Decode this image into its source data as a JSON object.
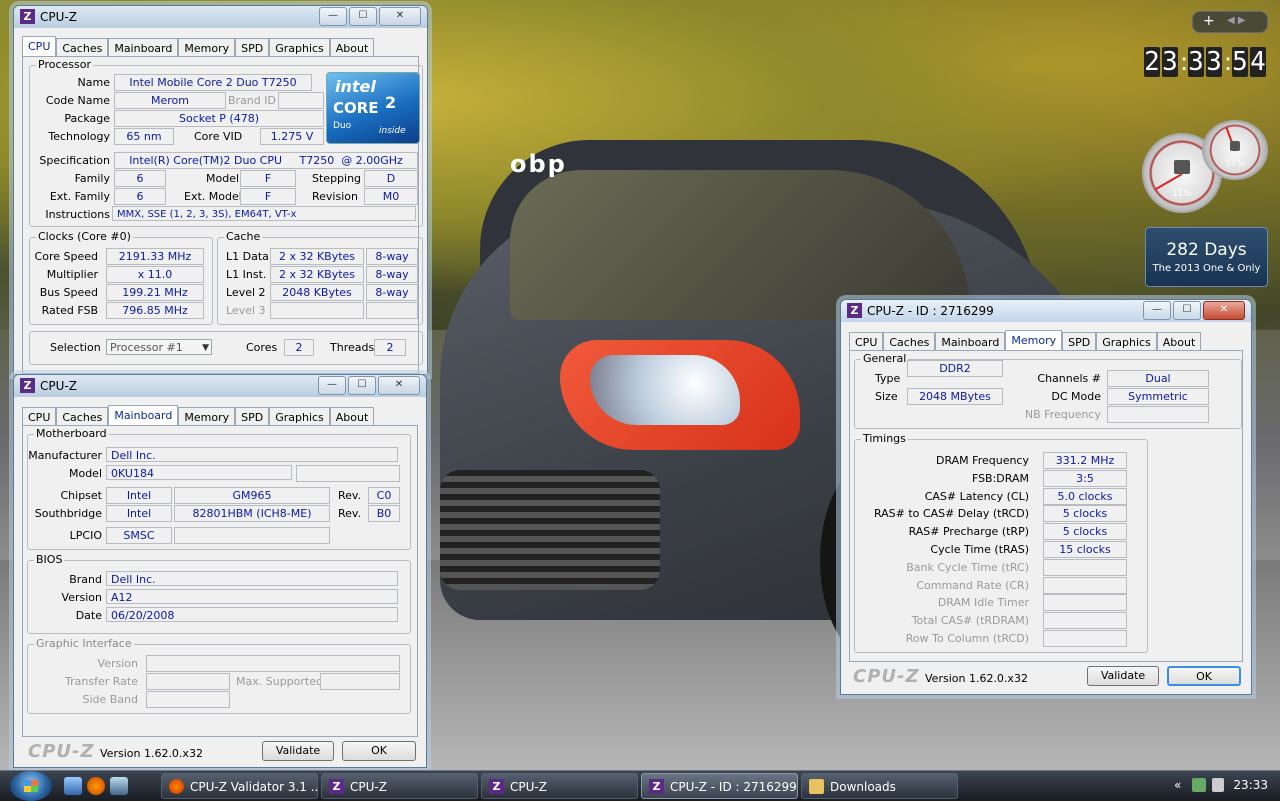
{
  "desktop": {
    "clock_digits": [
      "2",
      "3",
      "3",
      "3",
      "5",
      "4"
    ],
    "countdown": {
      "value": "282 Days",
      "caption": "The 2013 One & Only"
    },
    "meters": [
      {
        "label": "11%"
      },
      {
        "label": "57%"
      }
    ],
    "car_sticker": "obp"
  },
  "win_cpu": {
    "title": "CPU-Z",
    "tabs": [
      "CPU",
      "Caches",
      "Mainboard",
      "Memory",
      "SPD",
      "Graphics",
      "About"
    ],
    "processor": {
      "group": "Processor",
      "name_label": "Name",
      "name": "Intel Mobile Core 2 Duo T7250",
      "codename_label": "Code Name",
      "codename": "Merom",
      "brandid_label": "Brand ID",
      "package_label": "Package",
      "package": "Socket P (478)",
      "tech_label": "Technology",
      "tech": "65 nm",
      "corevid_label": "Core VID",
      "corevid": "1.275 V",
      "spec_label": "Specification",
      "spec": "Intel(R) Core(TM)2 Duo CPU     T7250  @ 2.00GHz",
      "family_label": "Family",
      "family": "6",
      "model_label": "Model",
      "model": "F",
      "stepping_label": "Stepping",
      "stepping": "D",
      "extfamily_label": "Ext. Family",
      "extfamily": "6",
      "extmodel_label": "Ext. Model",
      "extmodel": "F",
      "revision_label": "Revision",
      "revision": "M0",
      "instr_label": "Instructions",
      "instr": "MMX, SSE (1, 2, 3, 3S), EM64T, VT-x"
    },
    "logo": {
      "brand": "intel",
      "core": "CORE",
      "num": "2",
      "duo": "Duo",
      "inside": "inside"
    },
    "clocks": {
      "group": "Clocks (Core #0)",
      "corespeed_label": "Core Speed",
      "corespeed": "2191.33 MHz",
      "multiplier_label": "Multiplier",
      "multiplier": "x 11.0",
      "busspeed_label": "Bus Speed",
      "busspeed": "199.21 MHz",
      "ratedfsb_label": "Rated FSB",
      "ratedfsb": "796.85 MHz"
    },
    "cache": {
      "group": "Cache",
      "l1d_label": "L1 Data",
      "l1d": "2 x 32 KBytes",
      "l1d_way": "8-way",
      "l1i_label": "L1 Inst.",
      "l1i": "2 x 32 KBytes",
      "l1i_way": "8-way",
      "l2_label": "Level 2",
      "l2": "2048 KBytes",
      "l2_way": "8-way",
      "l3_label": "Level 3"
    },
    "selection_label": "Selection",
    "selection": "Processor #1",
    "cores_label": "Cores",
    "cores": "2",
    "threads_label": "Threads",
    "threads": "2"
  },
  "win_mb": {
    "title": "CPU-Z",
    "tabs": [
      "CPU",
      "Caches",
      "Mainboard",
      "Memory",
      "SPD",
      "Graphics",
      "About"
    ],
    "motherboard": {
      "group": "Motherboard",
      "manufacturer_label": "Manufacturer",
      "manufacturer": "Dell Inc.",
      "model_label": "Model",
      "model": "0KU184",
      "chipset_label": "Chipset",
      "chipset_vendor": "Intel",
      "chipset": "GM965",
      "rev_label": "Rev.",
      "chipset_rev": "C0",
      "southbridge_label": "Southbridge",
      "sb_vendor": "Intel",
      "sb": "82801HBM (ICH8-ME)",
      "sb_rev": "B0",
      "lpcio_label": "LPCIO",
      "lpcio": "SMSC"
    },
    "bios": {
      "group": "BIOS",
      "brand_label": "Brand",
      "brand": "Dell Inc.",
      "version_label": "Version",
      "version": "A12",
      "date_label": "Date",
      "date": "06/20/2008"
    },
    "graphic": {
      "group": "Graphic Interface",
      "version_label": "Version",
      "transfer_label": "Transfer Rate",
      "maxsup_label": "Max. Supported",
      "sideband_label": "Side Band"
    },
    "footer": {
      "logo": "CPU-Z",
      "version": "Version 1.62.0.x32",
      "validate": "Validate",
      "ok": "OK"
    }
  },
  "win_mem": {
    "title": "CPU-Z - ID : 2716299",
    "tabs": [
      "CPU",
      "Caches",
      "Mainboard",
      "Memory",
      "SPD",
      "Graphics",
      "About"
    ],
    "general": {
      "group": "General",
      "type_label": "Type",
      "type": "DDR2",
      "size_label": "Size",
      "size": "2048 MBytes",
      "channels_label": "Channels #",
      "channels": "Dual",
      "dcmode_label": "DC Mode",
      "dcmode": "Symmetric",
      "nbfreq_label": "NB Frequency"
    },
    "timings": {
      "group": "Timings",
      "rows": [
        {
          "label": "DRAM Frequency",
          "value": "331.2 MHz",
          "dis": false
        },
        {
          "label": "FSB:DRAM",
          "value": "3:5",
          "dis": false
        },
        {
          "label": "CAS# Latency (CL)",
          "value": "5.0 clocks",
          "dis": false
        },
        {
          "label": "RAS# to CAS# Delay (tRCD)",
          "value": "5 clocks",
          "dis": false
        },
        {
          "label": "RAS# Precharge (tRP)",
          "value": "5 clocks",
          "dis": false
        },
        {
          "label": "Cycle Time (tRAS)",
          "value": "15 clocks",
          "dis": false
        },
        {
          "label": "Bank Cycle Time (tRC)",
          "value": "",
          "dis": true
        },
        {
          "label": "Command Rate (CR)",
          "value": "",
          "dis": true
        },
        {
          "label": "DRAM Idle Timer",
          "value": "",
          "dis": true
        },
        {
          "label": "Total CAS# (tRDRAM)",
          "value": "",
          "dis": true
        },
        {
          "label": "Row To Column (tRCD)",
          "value": "",
          "dis": true
        }
      ]
    },
    "footer": {
      "logo": "CPU-Z",
      "version": "Version 1.62.0.x32",
      "validate": "Validate",
      "ok": "OK"
    }
  },
  "taskbar": {
    "tasks": [
      "CPU-Z Validator 3.1 ...",
      "CPU-Z",
      "CPU-Z",
      "CPU-Z - ID : 2716299",
      "Downloads"
    ],
    "time": "23:33"
  }
}
